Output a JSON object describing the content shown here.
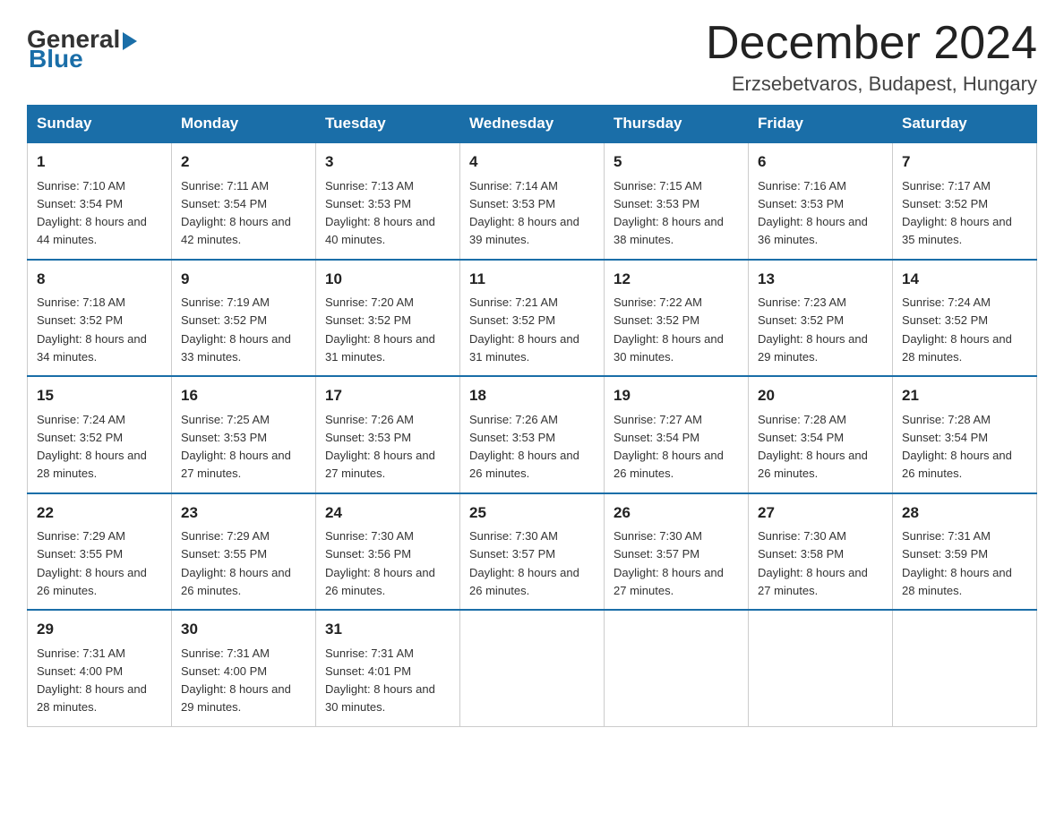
{
  "header": {
    "logo_general": "General",
    "logo_blue": "Blue",
    "month_title": "December 2024",
    "location": "Erzsebetvaros, Budapest, Hungary"
  },
  "weekdays": [
    "Sunday",
    "Monday",
    "Tuesday",
    "Wednesday",
    "Thursday",
    "Friday",
    "Saturday"
  ],
  "weeks": [
    [
      {
        "day": "1",
        "sunrise": "7:10 AM",
        "sunset": "3:54 PM",
        "daylight": "8 hours and 44 minutes."
      },
      {
        "day": "2",
        "sunrise": "7:11 AM",
        "sunset": "3:54 PM",
        "daylight": "8 hours and 42 minutes."
      },
      {
        "day": "3",
        "sunrise": "7:13 AM",
        "sunset": "3:53 PM",
        "daylight": "8 hours and 40 minutes."
      },
      {
        "day": "4",
        "sunrise": "7:14 AM",
        "sunset": "3:53 PM",
        "daylight": "8 hours and 39 minutes."
      },
      {
        "day": "5",
        "sunrise": "7:15 AM",
        "sunset": "3:53 PM",
        "daylight": "8 hours and 38 minutes."
      },
      {
        "day": "6",
        "sunrise": "7:16 AM",
        "sunset": "3:53 PM",
        "daylight": "8 hours and 36 minutes."
      },
      {
        "day": "7",
        "sunrise": "7:17 AM",
        "sunset": "3:52 PM",
        "daylight": "8 hours and 35 minutes."
      }
    ],
    [
      {
        "day": "8",
        "sunrise": "7:18 AM",
        "sunset": "3:52 PM",
        "daylight": "8 hours and 34 minutes."
      },
      {
        "day": "9",
        "sunrise": "7:19 AM",
        "sunset": "3:52 PM",
        "daylight": "8 hours and 33 minutes."
      },
      {
        "day": "10",
        "sunrise": "7:20 AM",
        "sunset": "3:52 PM",
        "daylight": "8 hours and 31 minutes."
      },
      {
        "day": "11",
        "sunrise": "7:21 AM",
        "sunset": "3:52 PM",
        "daylight": "8 hours and 31 minutes."
      },
      {
        "day": "12",
        "sunrise": "7:22 AM",
        "sunset": "3:52 PM",
        "daylight": "8 hours and 30 minutes."
      },
      {
        "day": "13",
        "sunrise": "7:23 AM",
        "sunset": "3:52 PM",
        "daylight": "8 hours and 29 minutes."
      },
      {
        "day": "14",
        "sunrise": "7:24 AM",
        "sunset": "3:52 PM",
        "daylight": "8 hours and 28 minutes."
      }
    ],
    [
      {
        "day": "15",
        "sunrise": "7:24 AM",
        "sunset": "3:52 PM",
        "daylight": "8 hours and 28 minutes."
      },
      {
        "day": "16",
        "sunrise": "7:25 AM",
        "sunset": "3:53 PM",
        "daylight": "8 hours and 27 minutes."
      },
      {
        "day": "17",
        "sunrise": "7:26 AM",
        "sunset": "3:53 PM",
        "daylight": "8 hours and 27 minutes."
      },
      {
        "day": "18",
        "sunrise": "7:26 AM",
        "sunset": "3:53 PM",
        "daylight": "8 hours and 26 minutes."
      },
      {
        "day": "19",
        "sunrise": "7:27 AM",
        "sunset": "3:54 PM",
        "daylight": "8 hours and 26 minutes."
      },
      {
        "day": "20",
        "sunrise": "7:28 AM",
        "sunset": "3:54 PM",
        "daylight": "8 hours and 26 minutes."
      },
      {
        "day": "21",
        "sunrise": "7:28 AM",
        "sunset": "3:54 PM",
        "daylight": "8 hours and 26 minutes."
      }
    ],
    [
      {
        "day": "22",
        "sunrise": "7:29 AM",
        "sunset": "3:55 PM",
        "daylight": "8 hours and 26 minutes."
      },
      {
        "day": "23",
        "sunrise": "7:29 AM",
        "sunset": "3:55 PM",
        "daylight": "8 hours and 26 minutes."
      },
      {
        "day": "24",
        "sunrise": "7:30 AM",
        "sunset": "3:56 PM",
        "daylight": "8 hours and 26 minutes."
      },
      {
        "day": "25",
        "sunrise": "7:30 AM",
        "sunset": "3:57 PM",
        "daylight": "8 hours and 26 minutes."
      },
      {
        "day": "26",
        "sunrise": "7:30 AM",
        "sunset": "3:57 PM",
        "daylight": "8 hours and 27 minutes."
      },
      {
        "day": "27",
        "sunrise": "7:30 AM",
        "sunset": "3:58 PM",
        "daylight": "8 hours and 27 minutes."
      },
      {
        "day": "28",
        "sunrise": "7:31 AM",
        "sunset": "3:59 PM",
        "daylight": "8 hours and 28 minutes."
      }
    ],
    [
      {
        "day": "29",
        "sunrise": "7:31 AM",
        "sunset": "4:00 PM",
        "daylight": "8 hours and 28 minutes."
      },
      {
        "day": "30",
        "sunrise": "7:31 AM",
        "sunset": "4:00 PM",
        "daylight": "8 hours and 29 minutes."
      },
      {
        "day": "31",
        "sunrise": "7:31 AM",
        "sunset": "4:01 PM",
        "daylight": "8 hours and 30 minutes."
      },
      null,
      null,
      null,
      null
    ]
  ]
}
